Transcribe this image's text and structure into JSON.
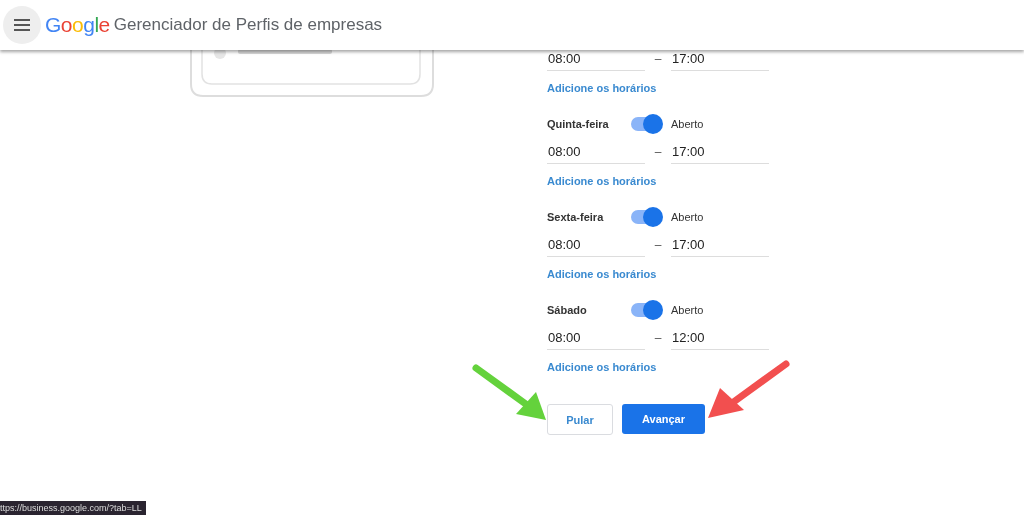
{
  "header": {
    "logo": "Google",
    "title": "Gerenciador de Perfis de empresas"
  },
  "hours": {
    "days": [
      {
        "kind": "partial",
        "opens": "08:00",
        "separator": "–",
        "closes": "17:00",
        "link": "Adicione os horários"
      },
      {
        "kind": "full",
        "name": "Quinta-feira",
        "on": true,
        "status": "Aberto",
        "opens": "08:00",
        "separator": "–",
        "closes": "17:00",
        "link": "Adicione os horários"
      },
      {
        "kind": "full",
        "name": "Sexta-feira",
        "on": true,
        "status": "Aberto",
        "opens": "08:00",
        "separator": "–",
        "closes": "17:00",
        "link": "Adicione os horários"
      },
      {
        "kind": "full",
        "name": "Sábado",
        "on": true,
        "status": "Aberto",
        "opens": "08:00",
        "separator": "–",
        "closes": "12:00",
        "link": "Adicione os horários"
      }
    ]
  },
  "buttons": {
    "skip": "Pular",
    "next": "Avançar"
  },
  "annotations": [
    {
      "kind": "arrow",
      "color": "#64d23c"
    },
    {
      "kind": "arrow",
      "color": "#f24f4f"
    }
  ],
  "status_bar": {
    "url": "ttps://business.google.com/?tab=LL"
  }
}
